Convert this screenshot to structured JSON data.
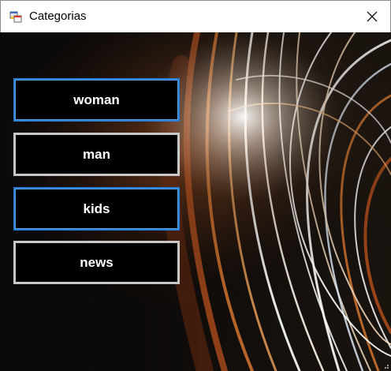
{
  "window": {
    "title": "Categorias"
  },
  "categories": [
    {
      "label": "woman",
      "focused": true
    },
    {
      "label": "man",
      "focused": false
    },
    {
      "label": "kids",
      "focused": true
    },
    {
      "label": "news",
      "focused": false
    }
  ],
  "icons": {
    "app": "app-window-icon",
    "close": "close-icon"
  },
  "colors": {
    "button_bg": "#000000",
    "button_border": "#c8c8c8",
    "focus_border": "#2a7fd6",
    "button_text": "#ffffff"
  }
}
